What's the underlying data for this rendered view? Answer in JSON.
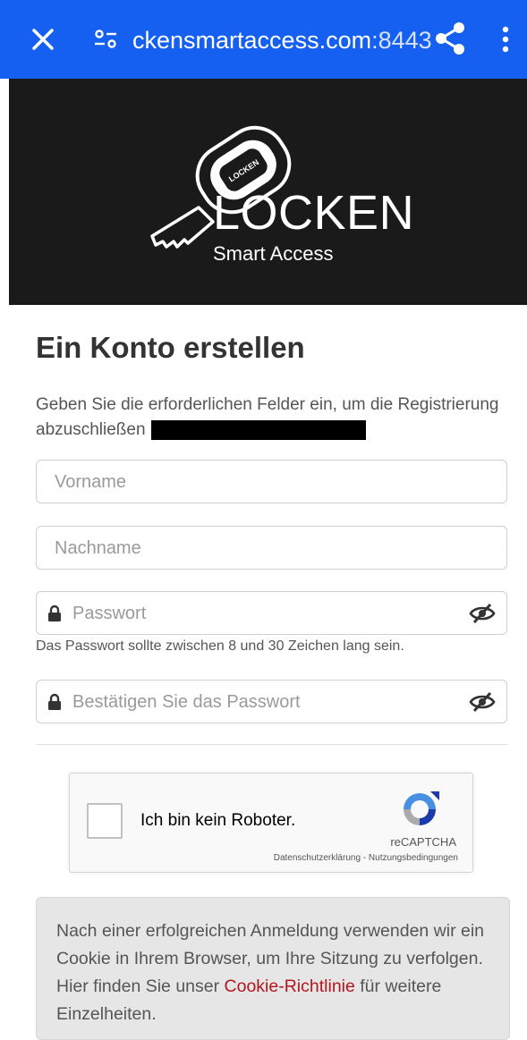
{
  "browser": {
    "url_main": "ckensmartaccess.com",
    "url_port": ":8443",
    "icons": [
      "close-icon",
      "site-settings-icon",
      "share-icon",
      "more-vert-icon"
    ]
  },
  "banner": {
    "brand": "LOCKEN",
    "subtitle": "Smart Access",
    "key_text": "LOCKEN"
  },
  "form": {
    "title": "Ein Konto erstellen",
    "intro": "Geben Sie die erforderlichen Felder ein, um die Registrierung abzuschließen",
    "firstname_placeholder": "Vorname",
    "lastname_placeholder": "Nachname",
    "password_placeholder": "Passwort",
    "password_hint": "Das Passwort sollte zwischen 8 und 30 Zeichen lang sein.",
    "confirm_placeholder": "Bestätigen Sie das Passwort"
  },
  "recaptcha": {
    "label": "Ich bin kein Roboter.",
    "brand": "reCAPTCHA",
    "privacy": "Datenschutzerklärung",
    "separator": " - ",
    "terms": "Nutzungsbedingungen"
  },
  "cookie": {
    "text_before": "Nach einer erfolgreichen Anmeldung verwenden wir ein Cookie in Ihrem Browser, um Ihre Sitzung zu verfolgen. Hier finden Sie unser ",
    "link": "Cookie-Richtlinie",
    "text_after": " für weitere Einzelheiten."
  },
  "colors": {
    "browser_bar": "#1560f0",
    "banner_bg": "#1a1a1a",
    "link_red": "#b5161d"
  }
}
